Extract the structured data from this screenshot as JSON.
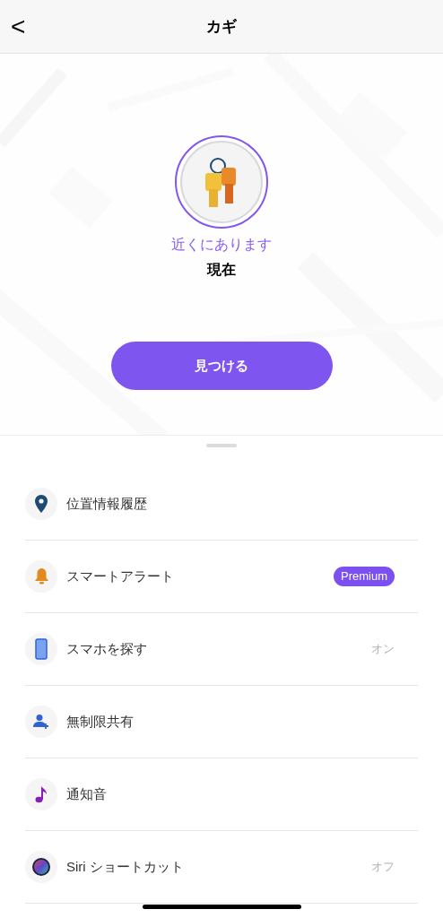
{
  "header": {
    "back": "<",
    "title": "カギ"
  },
  "device": {
    "status": "近くにあります",
    "time": "現在",
    "action": "見つける"
  },
  "menu": [
    {
      "kind": "history",
      "label": "位置情報履歴"
    },
    {
      "kind": "alert",
      "label": "スマートアラート",
      "trailing": {
        "kind": "badge",
        "text": "Premium"
      }
    },
    {
      "kind": "phone",
      "label": "スマホを探す",
      "trailing": {
        "kind": "value",
        "text": "オン"
      }
    },
    {
      "kind": "sharing",
      "label": "無制限共有"
    },
    {
      "kind": "sound",
      "label": "通知音"
    },
    {
      "kind": "shortcut",
      "label": "Siri ショートカット",
      "trailing": {
        "kind": "value",
        "text": "オフ"
      }
    }
  ]
}
